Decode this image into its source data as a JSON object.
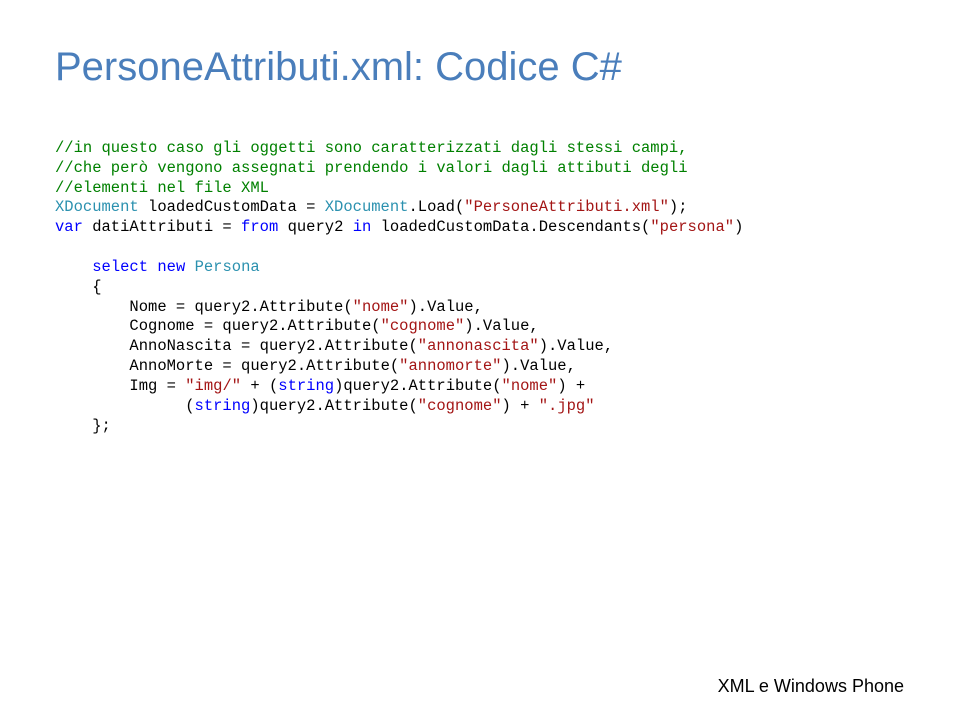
{
  "title": "PersoneAttributi.xml: Codice C#",
  "code": {
    "comment1": "//in questo caso gli oggetti sono caratterizzati dagli stessi campi,",
    "comment2": "//che però vengono assegnati prendendo i valori dagli attibuti degli",
    "comment3": "//elementi nel file XML",
    "type_xdocument": "XDocument",
    "var_loaded": " loadedCustomData = ",
    "dot_load": ".Load(",
    "str_loadfile": "\"PersoneAttributi.xml\"",
    "close_paren_semi": ");",
    "kw_var": "var",
    "var_datiattr": " datiAttributi = ",
    "kw_from": "from",
    "q2": " query2 ",
    "kw_in": "in",
    "loaded_desc": " loadedCustomData.Descendants(",
    "str_persona": "\"persona\"",
    "close_paren": ")",
    "indent4": "    ",
    "indent8": "        ",
    "kw_select": "select",
    "space": " ",
    "kw_new": "new",
    "type_persona": "Persona",
    "lbrace": "{",
    "nome_eq": "Nome = query2.Attribute(",
    "str_nome": "\"nome\"",
    "val_comma": ").Value,",
    "cognome_eq": "Cognome = query2.Attribute(",
    "str_cognome": "\"cognome\"",
    "annonascita_eq": "AnnoNascita = query2.Attribute(",
    "str_annonascita": "\"annonascita\"",
    "annomorte_eq": "AnnoMorte = query2.Attribute(",
    "str_annomorte": "\"annomorte\"",
    "img_eq": "Img = ",
    "str_imgslash": "\"img/\"",
    "plus_cast_open": " + (",
    "kw_string": "string",
    "cast_close_q2attr": ")query2.Attribute(",
    "close_paren_plus": ") +",
    "indent_cont": "              (",
    "str_jpg": "\".jpg\"",
    "close_plus_space": ") + ",
    "rbrace_semi": "};"
  },
  "footer": "XML e Windows Phone"
}
